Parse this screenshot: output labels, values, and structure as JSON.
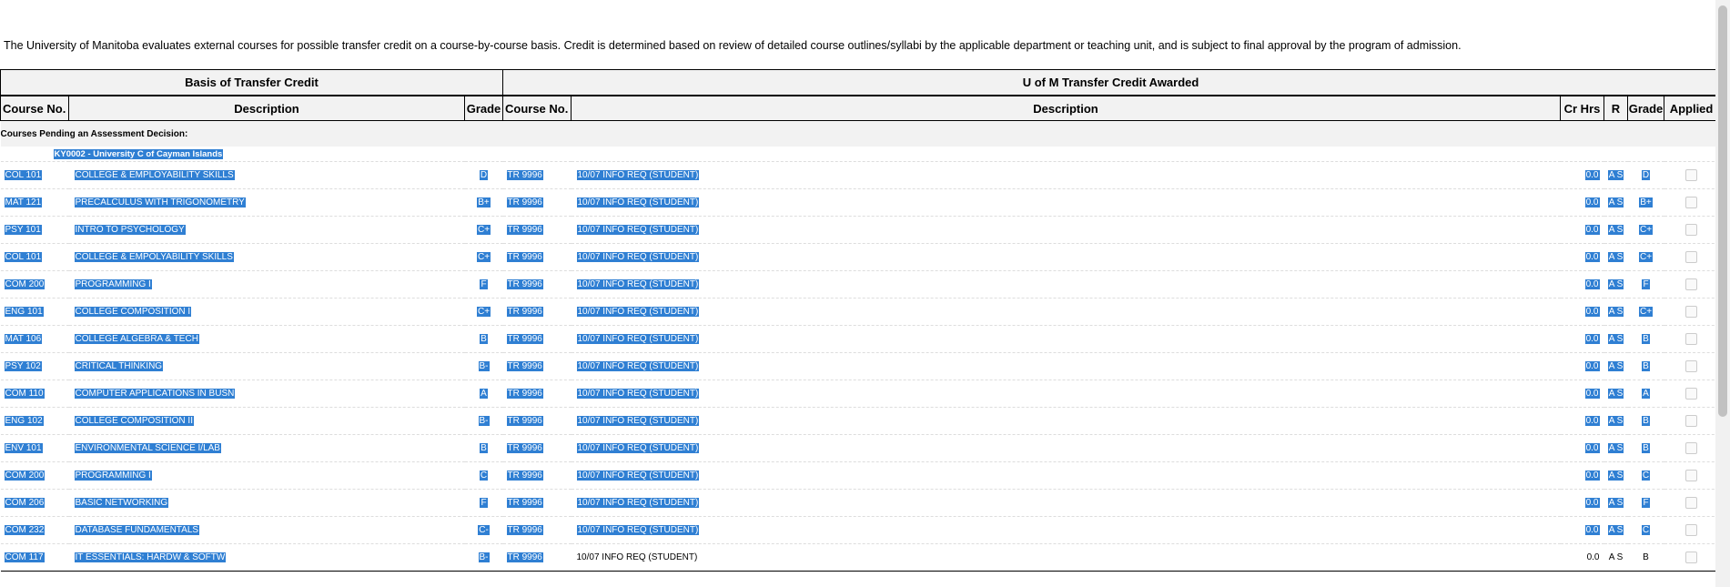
{
  "intro_text": "The University of Manitoba evaluates external courses for possible transfer credit on a course-by-course basis. Credit is determined based on review of detailed course outlines/syllabi by the applicable department or teaching unit, and is subject to final approval by the program of admission.",
  "table": {
    "group_headers": {
      "basis": "Basis of Transfer Credit",
      "awarded": "U of M Transfer Credit Awarded"
    },
    "columns": {
      "course_no": "Course No.",
      "description": "Description",
      "grade": "Grade",
      "um_course_no": "Course No.",
      "um_description": "Description",
      "cr_hrs": "Cr Hrs",
      "r": "R",
      "um_grade": "Grade",
      "applied": "Applied"
    },
    "pending_label": "Courses Pending an Assessment Decision:",
    "institution": "KY0002 - University C of Cayman Islands",
    "rows": [
      {
        "course_no": "COL 101",
        "description": "COLLEGE & EMPLOYABILITY SKILLS",
        "grade": "D",
        "um_course_no": "TR 9996",
        "um_description": "10/07 INFO REQ (STUDENT)",
        "cr_hrs": "0.0",
        "r": "A S",
        "um_grade": "D"
      },
      {
        "course_no": "MAT 121",
        "description": "PRECALCULUS WITH TRIGONOMETRY",
        "grade": "B+",
        "um_course_no": "TR 9996",
        "um_description": "10/07 INFO REQ (STUDENT)",
        "cr_hrs": "0.0",
        "r": "A S",
        "um_grade": "B+"
      },
      {
        "course_no": "PSY 101",
        "description": "INTRO TO PSYCHOLOGY",
        "grade": "C+",
        "um_course_no": "TR 9996",
        "um_description": "10/07 INFO REQ (STUDENT)",
        "cr_hrs": "0.0",
        "r": "A S",
        "um_grade": "C+"
      },
      {
        "course_no": "COL 101",
        "description": "COLLEGE & EMPOLYABILITY SKILLS",
        "grade": "C+",
        "um_course_no": "TR 9996",
        "um_description": "10/07 INFO REQ (STUDENT)",
        "cr_hrs": "0.0",
        "r": "A S",
        "um_grade": "C+"
      },
      {
        "course_no": "COM 200",
        "description": "PROGRAMMING I",
        "grade": "F",
        "um_course_no": "TR 9996",
        "um_description": "10/07 INFO REQ (STUDENT)",
        "cr_hrs": "0.0",
        "r": "A S",
        "um_grade": "F"
      },
      {
        "course_no": "ENG 101",
        "description": "COLLEGE COMPOSITION I",
        "grade": "C+",
        "um_course_no": "TR 9996",
        "um_description": "10/07 INFO REQ (STUDENT)",
        "cr_hrs": "0.0",
        "r": "A S",
        "um_grade": "C+"
      },
      {
        "course_no": "MAT 106",
        "description": "COLLEGE ALGEBRA & TECH",
        "grade": "B",
        "um_course_no": "TR 9996",
        "um_description": "10/07 INFO REQ (STUDENT)",
        "cr_hrs": "0.0",
        "r": "A S",
        "um_grade": "B"
      },
      {
        "course_no": "PSY 102",
        "description": "CRITICAL THINKING",
        "grade": "B-",
        "um_course_no": "TR 9996",
        "um_description": "10/07 INFO REQ (STUDENT)",
        "cr_hrs": "0.0",
        "r": "A S",
        "um_grade": "B"
      },
      {
        "course_no": "COM 110",
        "description": "COMPUTER APPLICATIONS IN BUSN",
        "grade": "A",
        "um_course_no": "TR 9996",
        "um_description": "10/07 INFO REQ (STUDENT)",
        "cr_hrs": "0.0",
        "r": "A S",
        "um_grade": "A"
      },
      {
        "course_no": "ENG 102",
        "description": "COLLEGE COMPOSITION II",
        "grade": "B-",
        "um_course_no": "TR 9996",
        "um_description": "10/07 INFO REQ (STUDENT)",
        "cr_hrs": "0.0",
        "r": "A S",
        "um_grade": "B"
      },
      {
        "course_no": "ENV 101",
        "description": "ENVIRONMENTAL SCIENCE I/LAB",
        "grade": "B",
        "um_course_no": "TR 9996",
        "um_description": "10/07 INFO REQ (STUDENT)",
        "cr_hrs": "0.0",
        "r": "A S",
        "um_grade": "B"
      },
      {
        "course_no": "COM 200",
        "description": "PROGRAMMING I",
        "grade": "C",
        "um_course_no": "TR 9996",
        "um_description": "10/07 INFO REQ (STUDENT)",
        "cr_hrs": "0.0",
        "r": "A S",
        "um_grade": "C"
      },
      {
        "course_no": "COM 206",
        "description": "BASIC NETWORKING",
        "grade": "F",
        "um_course_no": "TR 9996",
        "um_description": "10/07 INFO REQ (STUDENT)",
        "cr_hrs": "0.0",
        "r": "A S",
        "um_grade": "F"
      },
      {
        "course_no": "COM 232",
        "description": "DATABASE FUNDAMENTALS",
        "grade": "C-",
        "um_course_no": "TR 9996",
        "um_description": "10/07 INFO REQ (STUDENT)",
        "cr_hrs": "0.0",
        "r": "A S",
        "um_grade": "C"
      },
      {
        "course_no": "COM 117",
        "description": "IT ESSENTIALS: HARDW & SOFTW",
        "grade": "B-",
        "um_course_no": "TR 9996",
        "um_description": "10/07 INFO REQ (STUDENT)",
        "cr_hrs": "0.0",
        "r": "A S",
        "um_grade": "B"
      }
    ]
  },
  "colors": {
    "selection": "#2f7fd3",
    "header_bg": "#f2f2f2"
  }
}
